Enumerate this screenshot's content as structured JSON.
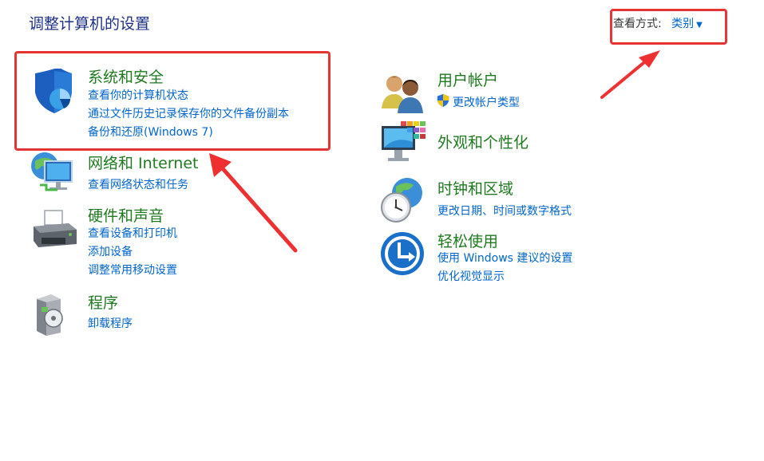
{
  "header": {
    "title": "调整计算机的设置",
    "view_by_label": "查看方式:",
    "view_by_value": "类别"
  },
  "left": [
    {
      "title": "系统和安全",
      "icon": "shield-icon",
      "links": [
        "查看你的计算机状态",
        "通过文件历史记录保存你的文件备份副本",
        "备份和还原(Windows 7)"
      ]
    },
    {
      "title": "网络和 Internet",
      "icon": "network-icon",
      "links": [
        "查看网络状态和任务"
      ]
    },
    {
      "title": "硬件和声音",
      "icon": "printer-icon",
      "links": [
        "查看设备和打印机",
        "添加设备",
        "调整常用移动设置"
      ]
    },
    {
      "title": "程序",
      "icon": "programs-icon",
      "links": [
        "卸载程序"
      ]
    }
  ],
  "right": [
    {
      "title": "用户帐户",
      "icon": "users-icon",
      "links": [
        "更改帐户类型"
      ]
    },
    {
      "title": "外观和个性化",
      "icon": "appearance-icon",
      "links": []
    },
    {
      "title": "时钟和区域",
      "icon": "clock-globe-icon",
      "links": [
        "更改日期、时间或数字格式"
      ]
    },
    {
      "title": "轻松使用",
      "icon": "ease-of-access-icon",
      "links": [
        "使用 Windows 建议的设置",
        "优化视觉显示"
      ]
    }
  ],
  "colors": {
    "title": "#1e3287",
    "category": "#1f7a1f",
    "link": "#0066cc",
    "annotation": "#e53535"
  }
}
